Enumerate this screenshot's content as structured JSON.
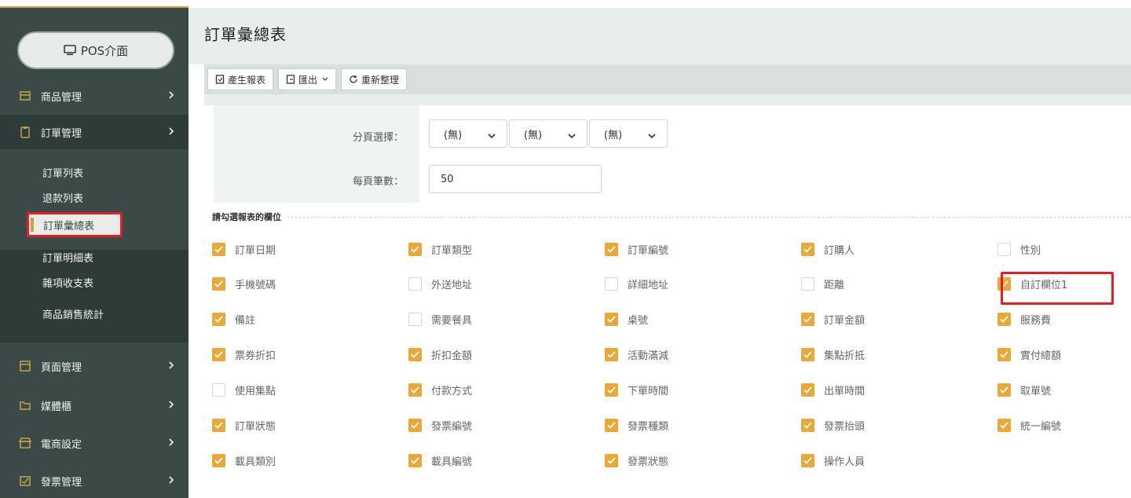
{
  "sidebar": {
    "pos_button": "POS介面",
    "menu": [
      {
        "label": "商品管理"
      },
      {
        "label": "訂單管理"
      },
      {
        "label": "頁面管理"
      },
      {
        "label": "媒體櫃"
      },
      {
        "label": "電商設定"
      },
      {
        "label": "發票管理"
      }
    ],
    "submenu": [
      "訂單列表",
      "退款列表",
      "訂單彙總表",
      "訂單明細表",
      "雜項收支表",
      "商品銷售統計"
    ],
    "active_submenu": "訂單彙總表"
  },
  "header": {
    "title": "訂單彙總表"
  },
  "toolbar": {
    "generate_label": "產生報表",
    "export_label": "匯出",
    "reset_label": "重新整理"
  },
  "form": {
    "paging_label": "分頁選擇：",
    "paging_selects": [
      "(無)",
      "(無)",
      "(無)"
    ],
    "per_page_label": "每頁筆數：",
    "per_page_value": "50"
  },
  "columns_section": {
    "legend": "請勾選報表的欄位",
    "rows": [
      [
        {
          "label": "訂單日期",
          "checked": true
        },
        {
          "label": "訂單類型",
          "checked": true
        },
        {
          "label": "訂單編號",
          "checked": true
        },
        {
          "label": "訂購人",
          "checked": true
        },
        {
          "label": "性別",
          "checked": false
        }
      ],
      [
        {
          "label": "手機號碼",
          "checked": true
        },
        {
          "label": "外送地址",
          "checked": false
        },
        {
          "label": "詳細地址",
          "checked": false
        },
        {
          "label": "距離",
          "checked": false
        },
        {
          "label": "自訂欄位1",
          "checked": true
        }
      ],
      [
        {
          "label": "備註",
          "checked": true
        },
        {
          "label": "需要餐具",
          "checked": false
        },
        {
          "label": "桌號",
          "checked": true
        },
        {
          "label": "訂單金額",
          "checked": true
        },
        {
          "label": "服務費",
          "checked": true
        }
      ],
      [
        {
          "label": "票券折扣",
          "checked": true
        },
        {
          "label": "折扣金額",
          "checked": true
        },
        {
          "label": "活動滿減",
          "checked": true
        },
        {
          "label": "集點折抵",
          "checked": true
        },
        {
          "label": "實付總額",
          "checked": true
        }
      ],
      [
        {
          "label": "使用集點",
          "checked": false
        },
        {
          "label": "付款方式",
          "checked": true
        },
        {
          "label": "下單時間",
          "checked": true
        },
        {
          "label": "出單時間",
          "checked": true
        },
        {
          "label": "取單號",
          "checked": true
        }
      ],
      [
        {
          "label": "訂單狀態",
          "checked": true
        },
        {
          "label": "發票編號",
          "checked": true
        },
        {
          "label": "發票種類",
          "checked": true
        },
        {
          "label": "發票抬頭",
          "checked": true
        },
        {
          "label": "統一編號",
          "checked": true
        }
      ],
      [
        {
          "label": "載具類別",
          "checked": true
        },
        {
          "label": "載具編號",
          "checked": true
        },
        {
          "label": "發票狀態",
          "checked": true
        },
        {
          "label": "操作人員",
          "checked": true
        }
      ]
    ]
  },
  "colors": {
    "accent": "#e9a83a",
    "sidebar": "#3b4a47",
    "highlight": "#e41e25"
  }
}
